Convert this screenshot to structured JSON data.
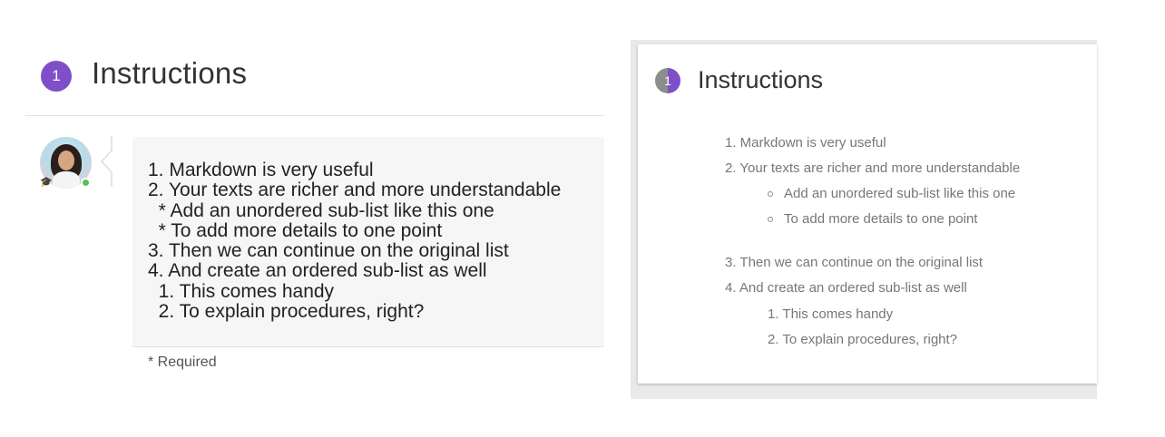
{
  "left": {
    "step_number": "1",
    "title": "Instructions",
    "avatar_icon": "user-avatar-photo",
    "role_icon": "graduation-cap-icon",
    "status_color": "#5bbf55",
    "raw_lines": [
      "1. Markdown is very useful",
      "2. Your texts are richer and more understandable",
      "  * Add an unordered sub-list like this one",
      "  * To add more details to one point",
      "3. Then we can continue on the original list",
      "4. And create an ordered sub-list as well",
      "  1. This comes handy",
      "  2. To explain procedures, right?"
    ],
    "required_note": "* Required"
  },
  "right": {
    "step_number": "1",
    "title": "Instructions",
    "list": [
      "1. Markdown is very useful",
      "2. Your texts are richer and more understandable",
      "Add an unordered sub-list like this one",
      "To add more details to one point",
      "3. Then we can continue on the original list",
      "4. And create an ordered sub-list as well",
      "1. This comes handy",
      "2. To explain procedures, right?"
    ]
  },
  "colors": {
    "accent": "#7e4fc8",
    "badge_grey": "#8c8c8c"
  }
}
